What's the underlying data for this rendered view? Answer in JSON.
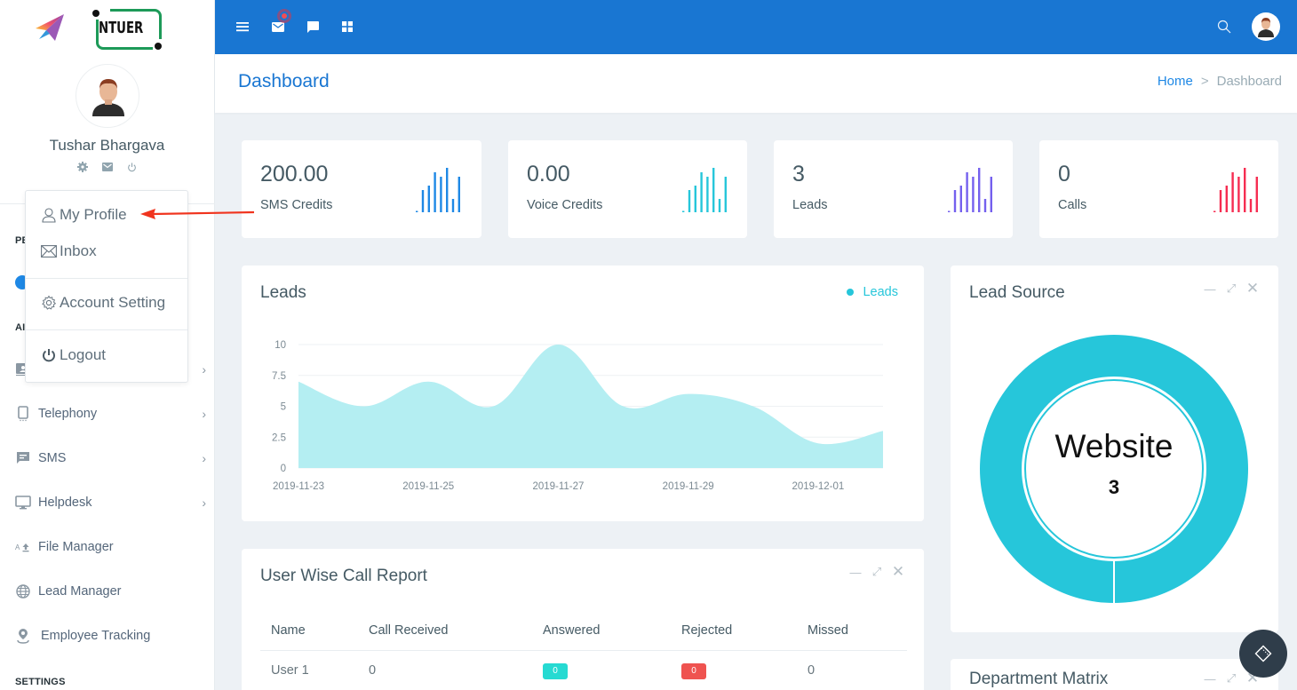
{
  "app": {
    "brand_text": "NTUER"
  },
  "topbar": {
    "icons": [
      "menu-icon",
      "mail-icon",
      "chat-icon",
      "apps-grid-icon",
      "search-icon"
    ]
  },
  "user": {
    "name": "Tushar Bhargava",
    "icons": [
      "gear-icon",
      "mail-icon",
      "power-icon"
    ]
  },
  "profile_menu": {
    "items": [
      {
        "label": "My Profile",
        "icon": "user-icon"
      },
      {
        "label": "Inbox",
        "icon": "envelope-icon"
      },
      {
        "label": "Account Setting",
        "icon": "gear-icon"
      },
      {
        "label": "Logout",
        "icon": "power-icon"
      }
    ]
  },
  "sidebar": {
    "sections": [
      {
        "label": "PE"
      },
      {
        "label": "AI"
      },
      {
        "label": "SETTINGS"
      }
    ],
    "items": [
      {
        "label": "Telephony",
        "icon": "mobile-icon",
        "has_children": true
      },
      {
        "label": "SMS",
        "icon": "message-icon",
        "has_children": true
      },
      {
        "label": "Helpdesk",
        "icon": "monitor-icon",
        "has_children": true
      },
      {
        "label": "File Manager",
        "icon": "file-upload-icon",
        "has_children": false
      },
      {
        "label": "Lead Manager",
        "icon": "globe-icon",
        "has_children": false
      },
      {
        "label": "Employee Tracking",
        "icon": "location-pin-icon",
        "has_children": false
      }
    ]
  },
  "page": {
    "title": "Dashboard",
    "breadcrumb": {
      "home": "Home",
      "separator": ">",
      "current": "Dashboard"
    }
  },
  "stats": [
    {
      "value": "200.00",
      "label": "SMS Credits",
      "color": "#1e88e5",
      "spark": [
        0,
        5,
        6,
        9,
        8,
        10,
        3,
        8
      ]
    },
    {
      "value": "0.00",
      "label": "Voice Credits",
      "color": "#26c6da",
      "spark": [
        0,
        5,
        6,
        9,
        8,
        10,
        3,
        8
      ]
    },
    {
      "value": "3",
      "label": "Leads",
      "color": "#7460ee",
      "spark": [
        0,
        5,
        6,
        9,
        8,
        10,
        3,
        8
      ]
    },
    {
      "value": "0",
      "label": "Calls",
      "color": "#f62d51",
      "spark": [
        0,
        5,
        6,
        9,
        8,
        10,
        3,
        8
      ]
    }
  ],
  "chart_data": [
    {
      "type": "area",
      "title": "Leads",
      "legend": [
        {
          "name": "Leads",
          "color": "#26c6da"
        }
      ],
      "legend_position": "top-right",
      "x": [
        "2019-11-23",
        "2019-11-24",
        "2019-11-25",
        "2019-11-26",
        "2019-11-27",
        "2019-11-28",
        "2019-11-29",
        "2019-11-30",
        "2019-12-01",
        "2019-12-02"
      ],
      "x_tick_labels": [
        "2019-11-23",
        "2019-11-25",
        "2019-11-27",
        "2019-11-29",
        "2019-12-01"
      ],
      "series": [
        {
          "name": "Leads",
          "values": [
            7,
            5,
            7,
            5,
            10,
            5,
            6,
            5,
            2,
            3
          ]
        }
      ],
      "y_ticks": [
        "0",
        "2.5",
        "5",
        "7.5",
        "10"
      ],
      "ylim": [
        0,
        10
      ],
      "grid": true,
      "fill_color": "#b4eef2"
    },
    {
      "type": "pie",
      "title": "Lead Source",
      "donut": true,
      "slices": [
        {
          "label": "Website",
          "value": 3,
          "color": "#26c6da"
        }
      ],
      "center_label": "Website",
      "center_value": "3"
    }
  ],
  "panels": {
    "leads_title": "Leads",
    "lead_source_title": "Lead Source",
    "call_report_title": "User Wise Call Report",
    "department_title": "Department Matrix",
    "window_controls": [
      "minimize-icon",
      "expand-icon",
      "close-icon"
    ]
  },
  "call_report": {
    "columns": [
      "Name",
      "Call Received",
      "Answered",
      "Rejected",
      "Missed"
    ],
    "rows": [
      {
        "name": "User 1",
        "received": "0",
        "answered": "0",
        "rejected": "0",
        "missed": "0"
      }
    ],
    "badge_colors": {
      "answered": "#26dad2",
      "rejected": "#ef5350"
    }
  }
}
